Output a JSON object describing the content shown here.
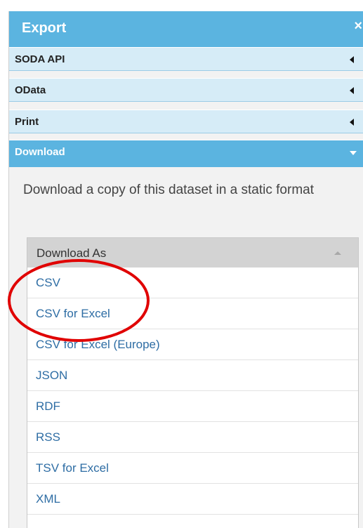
{
  "panel": {
    "title": "Export",
    "close_glyph": "×",
    "header_color": "#5bb4e0"
  },
  "sections": [
    {
      "label": "SODA API",
      "state": "collapsed"
    },
    {
      "label": "OData",
      "state": "collapsed"
    },
    {
      "label": "Print",
      "state": "collapsed"
    },
    {
      "label": "Download",
      "state": "expanded"
    }
  ],
  "download": {
    "description": "Download a copy of this dataset in a static format",
    "dropdown_label": "Download As",
    "options": [
      "CSV",
      "CSV for Excel",
      "CSV for Excel (Europe)",
      "JSON",
      "RDF",
      "RSS",
      "TSV for Excel",
      "XML"
    ]
  },
  "annotation": {
    "shape": "ellipse",
    "color": "#e00000"
  },
  "icons": {
    "collapsed": "caret-left-icon",
    "expanded": "caret-down-icon",
    "dropdown_open": "caret-up-icon",
    "close": "close-icon"
  }
}
